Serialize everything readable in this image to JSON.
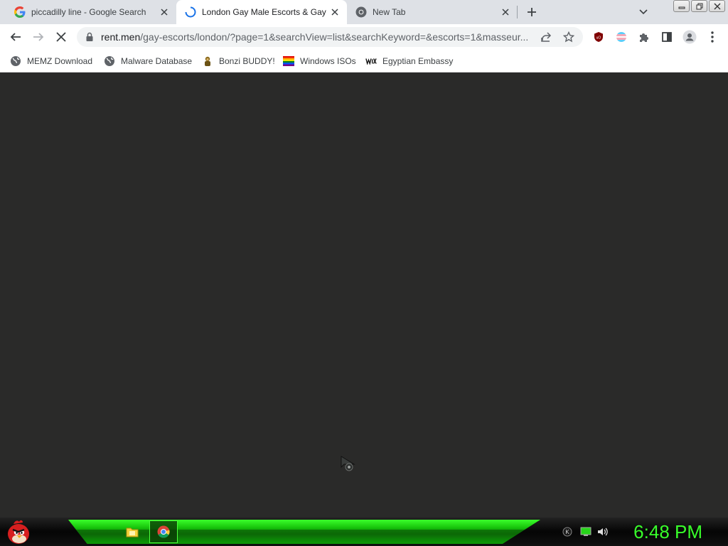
{
  "browser": {
    "tabs": [
      {
        "title": "piccadilly line - Google Search",
        "favicon": "google-g-icon",
        "active": false
      },
      {
        "title": "London Gay Male Escorts & Gay",
        "favicon": "loading-spinner-icon",
        "active": true
      },
      {
        "title": "New Tab",
        "favicon": "chrome-icon",
        "active": false
      }
    ],
    "url_host": "rent.men",
    "url_path": "/gay-escorts/london/?page=1&searchView=list&searchKeyword=&escorts=1&masseur..."
  },
  "bookmarks": [
    {
      "label": "MEMZ Download",
      "icon": "globe-icon"
    },
    {
      "label": "Malware Database",
      "icon": "globe-icon"
    },
    {
      "label": "Bonzi BUDDY!",
      "icon": "bonzi-icon"
    },
    {
      "label": "Windows ISOs",
      "icon": "rainbow-flag-icon"
    },
    {
      "label": "Egyptian Embassy",
      "icon": "wix-icon"
    }
  ],
  "taskbar": {
    "clock": "6:48 PM",
    "apps": [
      "file-explorer-icon",
      "chrome-icon"
    ],
    "tray": [
      "keyboard-icon",
      "network-icon",
      "volume-icon"
    ]
  },
  "colors": {
    "accent_green": "#38ff2a",
    "content_bg": "#2a2a29",
    "tabstrip_bg": "#dee1e6"
  }
}
